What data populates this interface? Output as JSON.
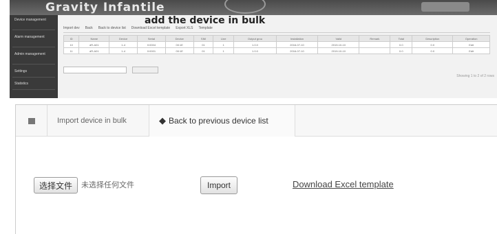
{
  "top_screenshot": {
    "brand": "Gravity Infantile",
    "title": "add the device in bulk",
    "sidebar_items": [
      "Device management",
      "Alarm management",
      "Admin management",
      "Settings",
      "Statistics"
    ],
    "tabs": [
      "Import dev",
      "Back",
      "Back to device list",
      "Download Excel template",
      "Export XLS",
      "Template"
    ],
    "table_rows": [
      [
        "ID",
        "Name",
        "Device",
        "Serial",
        "Device",
        "SIM",
        "Line",
        "Output grou",
        "Installation",
        "Valid",
        "Remark",
        "Total",
        "Description",
        "Operation"
      ],
      [
        "10",
        "dR-A01",
        "1-4",
        "0:0004",
        "00:1E",
        "01",
        "1",
        "1.0.0",
        "2016-07-10",
        "2019-10-10",
        "",
        "0.0",
        "0.0",
        "Edit"
      ],
      [
        "11",
        "dR-A01",
        "1-4",
        "0:0001",
        "00:1E",
        "01",
        "1",
        "1.0.0",
        "2016-07-10",
        "2019-10-10",
        "",
        "0.0",
        "0.0",
        "Edit"
      ]
    ],
    "footer_pager": "Showing 1 to 2 of 2 rows"
  },
  "toolbar": {
    "menu_icon": "hamburger-icon",
    "import_tab_label": "Import device in bulk",
    "back_arrow": "◆",
    "back_label": "Back to previous device list"
  },
  "form": {
    "choose_file_label": "选择文件",
    "no_file_label": "未选择任何文件",
    "import_label": "Import",
    "download_template_label": "Download Excel template"
  }
}
